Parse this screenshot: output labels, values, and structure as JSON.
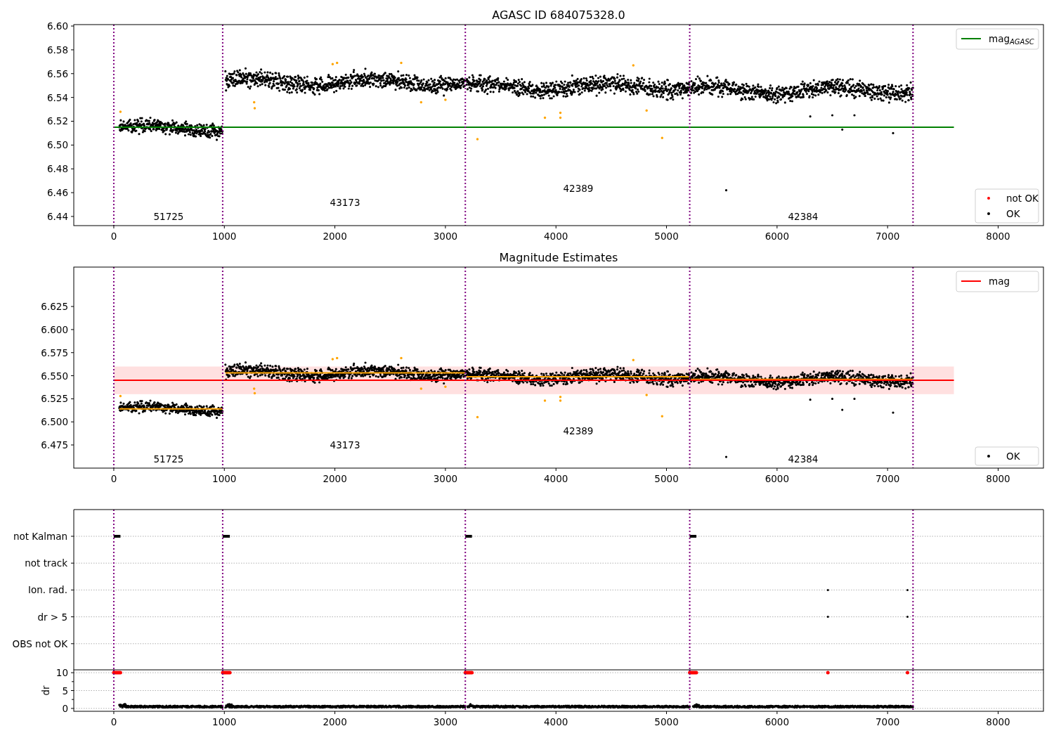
{
  "panels": [
    {
      "kind": "scatter",
      "title": "AGASC ID 684075328.0",
      "line_legend": [
        {
          "label": "mag$_{AGASC}$",
          "color": "#008000"
        }
      ],
      "marker_legend": [
        {
          "label": "not OK",
          "color": "#ff0000"
        },
        {
          "label": "OK",
          "color": "#000000"
        }
      ],
      "obsid_labels": [
        "51725",
        "43173",
        "42389",
        "42384"
      ],
      "chart_data": {
        "type": "scatter",
        "xlim": [
          -362,
          8410
        ],
        "ylim": [
          6.4323,
          6.6012
        ],
        "xticks": [
          0,
          1000,
          2000,
          3000,
          4000,
          5000,
          6000,
          7000,
          8000
        ],
        "yticks": [
          {
            "value": 6.44,
            "label": "6.44"
          },
          {
            "value": 6.46,
            "label": "6.46"
          },
          {
            "value": 6.48,
            "label": "6.48"
          },
          {
            "value": 6.5,
            "label": "6.50"
          },
          {
            "value": 6.52,
            "label": "6.52"
          },
          {
            "value": 6.54,
            "label": "6.54"
          },
          {
            "value": 6.56,
            "label": "6.56"
          },
          {
            "value": 6.58,
            "label": "6.58"
          },
          {
            "value": 6.6,
            "label": "6.60"
          }
        ],
        "ref_lines": [
          {
            "axis": "y",
            "value": 6.515,
            "color": "#008000"
          },
          {
            "axis": "x",
            "value": 0,
            "color": "#800080"
          },
          {
            "axis": "x",
            "value": 985,
            "color": "#800080"
          },
          {
            "axis": "x",
            "value": 3180,
            "color": "#800080"
          },
          {
            "axis": "x",
            "value": 5210,
            "color": "#800080"
          },
          {
            "axis": "x",
            "value": 7230,
            "color": "#800080"
          }
        ]
      }
    },
    {
      "kind": "scatter",
      "title": "Magnitude Estimates",
      "line_legend": [
        {
          "label": "mag",
          "color": "#ff0000"
        }
      ],
      "marker_legend": [
        {
          "label": "OK",
          "color": "#000000"
        }
      ],
      "obsid_labels": [
        "51725",
        "43173",
        "42389",
        "42384"
      ],
      "chart_data": {
        "type": "line",
        "xlim": [
          -362,
          8410
        ],
        "ylim": [
          6.4499,
          6.6677
        ],
        "xticks": [
          0,
          1000,
          2000,
          3000,
          4000,
          5000,
          6000,
          7000,
          8000
        ],
        "yticks": [
          {
            "value": 6.475,
            "label": "6.475"
          },
          {
            "value": 6.5,
            "label": "6.500"
          },
          {
            "value": 6.525,
            "label": "6.525"
          },
          {
            "value": 6.55,
            "label": "6.550"
          },
          {
            "value": 6.575,
            "label": "6.575"
          },
          {
            "value": 6.6,
            "label": "6.600"
          },
          {
            "value": 6.625,
            "label": "6.625"
          }
        ],
        "x": [
          50,
          985,
          1010,
          3180,
          3190,
          5210,
          5220,
          7230
        ],
        "series": [
          {
            "color": "#ffa500",
            "values": [
              6.514,
              6.514,
              null,
              null,
              null,
              null,
              null,
              null
            ]
          },
          {
            "color": "#ffa500",
            "values": [
              null,
              null,
              6.553,
              6.553,
              null,
              null,
              null,
              null
            ]
          },
          {
            "color": "#ffa500",
            "values": [
              null,
              null,
              null,
              null,
              6.549,
              6.549,
              null,
              null
            ]
          },
          {
            "color": "#ffa500",
            "values": [
              null,
              null,
              null,
              null,
              null,
              null,
              6.546,
              6.546
            ]
          }
        ],
        "ref_lines": [
          {
            "axis": "y",
            "value": 6.545,
            "color": "#ff0000"
          },
          {
            "axis": "x",
            "value": 0,
            "color": "#800080"
          },
          {
            "axis": "x",
            "value": 985,
            "color": "#800080"
          },
          {
            "axis": "x",
            "value": 3180,
            "color": "#800080"
          },
          {
            "axis": "x",
            "value": 5210,
            "color": "#800080"
          },
          {
            "axis": "x",
            "value": 7230,
            "color": "#800080"
          }
        ],
        "bands": [
          {
            "axis": "y",
            "from": 6.53,
            "to": 6.56,
            "color": "#ff0000"
          }
        ]
      }
    },
    {
      "kind": "flags",
      "flag_labels": [
        "not Kalman",
        "not track",
        "Ion. rad.",
        "dr > 5",
        "OBS not OK"
      ],
      "chart_data": {
        "type": "scatter",
        "ylabel": "dr",
        "xlim": [
          -362,
          8410
        ],
        "ylim": [
          -0.8,
          10.8
        ],
        "xticks": [
          0,
          1000,
          2000,
          3000,
          4000,
          5000,
          6000,
          7000,
          8000
        ],
        "yticks": [
          0,
          5,
          10
        ],
        "grid": true,
        "ref_lines": [
          {
            "axis": "x",
            "value": 0,
            "color": "#800080"
          },
          {
            "axis": "x",
            "value": 985,
            "color": "#800080"
          },
          {
            "axis": "x",
            "value": 3180,
            "color": "#800080"
          },
          {
            "axis": "x",
            "value": 5210,
            "color": "#800080"
          },
          {
            "axis": "x",
            "value": 7230,
            "color": "#800080"
          }
        ]
      }
    }
  ]
}
